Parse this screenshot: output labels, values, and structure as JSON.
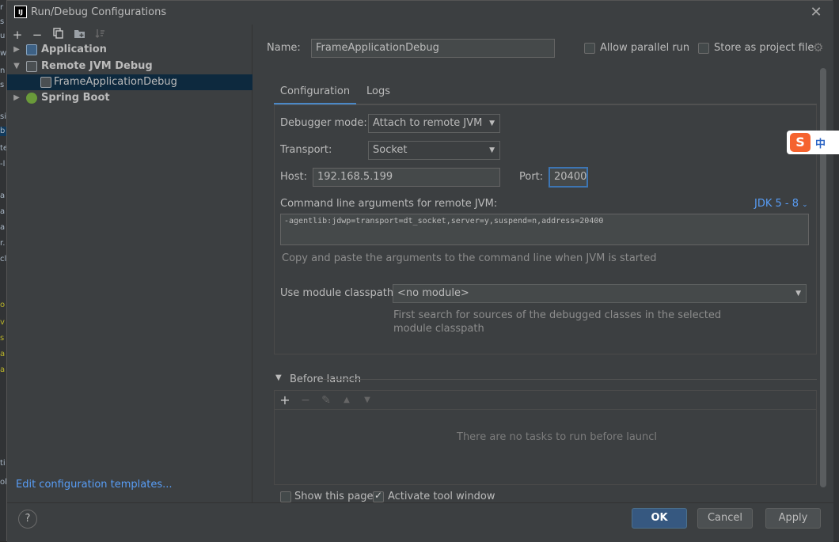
{
  "window": {
    "title": "Run/Debug Configurations",
    "logo_text": "IJ"
  },
  "left_toolbar": {
    "icons": [
      "add-icon",
      "remove-icon",
      "copy-icon",
      "folder-icon",
      "sort-icon"
    ]
  },
  "tree": {
    "items": [
      {
        "label": "Application",
        "bold": true,
        "expanded": false
      },
      {
        "label": "Remote JVM Debug",
        "bold": true,
        "expanded": true
      },
      {
        "label": "FrameApplicationDebug",
        "bold": false,
        "selected": true
      },
      {
        "label": "Spring Boot",
        "bold": true,
        "expanded": false
      }
    ]
  },
  "edit_templates_link": "Edit configuration templates...",
  "header": {
    "name_label": "Name:",
    "name_value": "FrameApplicationDebug",
    "allow_parallel_label": "Allow parallel run",
    "store_as_project_label": "Store as project file"
  },
  "tabs": [
    {
      "label": "Configuration",
      "active": true
    },
    {
      "label": "Logs",
      "active": false
    }
  ],
  "config": {
    "debugger_mode_label": "Debugger mode:",
    "debugger_mode_value": "Attach to remote JVM",
    "transport_label": "Transport:",
    "transport_value": "Socket",
    "host_label": "Host:",
    "host_value": "192.168.5.199",
    "port_label": "Port:",
    "port_value": "20400",
    "cmd_label": "Command line arguments for remote JVM:",
    "jdk_selector": "JDK 5 - 8",
    "cmd_value": "-agentlib:jdwp=transport=dt_socket,server=y,suspend=n,address=20400",
    "cmd_hint": "Copy and paste the arguments to the command line when JVM is started",
    "module_label": "Use module classpath:",
    "module_value": "<no module>",
    "module_hint_line1": "First search for sources of the debugged classes in the selected",
    "module_hint_line2": "module classpath"
  },
  "before_launch": {
    "label": "Before launch",
    "empty_text": "There are no tasks to run before launcl",
    "icons": [
      "add-icon",
      "remove-icon",
      "edit-icon",
      "move-up-icon",
      "move-down-icon"
    ]
  },
  "footer_options": {
    "show_page_label": "Show this page",
    "activate_tool_label": "Activate tool window"
  },
  "buttons": {
    "help": "?",
    "ok": "OK",
    "cancel": "Cancel",
    "apply": "Apply"
  },
  "ime_badge": {
    "s": "S",
    "lang": "中"
  },
  "colors": {
    "accent": "#4a88c7",
    "link": "#589df6",
    "selection": "#0d293e",
    "ok_button": "#365880"
  }
}
